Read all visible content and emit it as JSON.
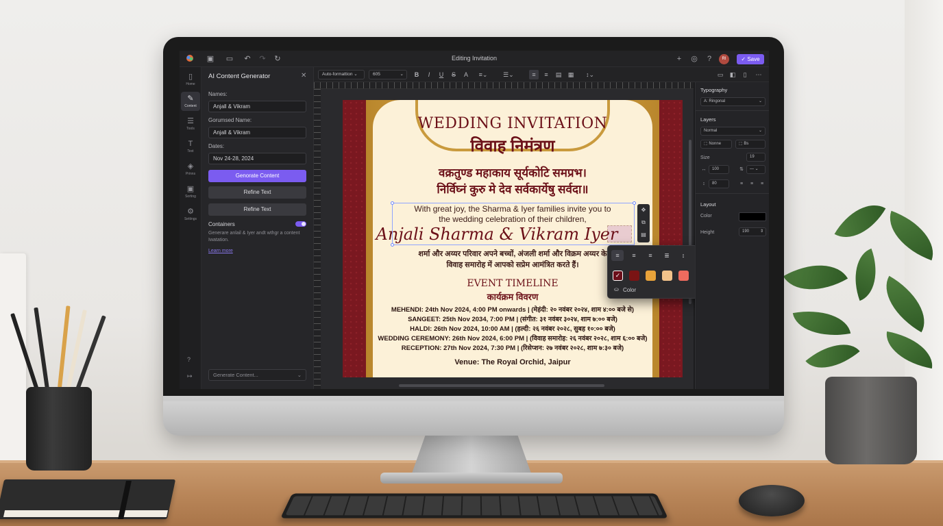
{
  "app": {
    "title": "Editing Invitation",
    "save_label": "Save",
    "avatar_initials": "RI"
  },
  "rail": {
    "items": [
      {
        "label": "Home",
        "icon": "layout-icon"
      },
      {
        "label": "Content",
        "icon": "magic-pen-icon"
      },
      {
        "label": "Tools",
        "icon": "tools-icon"
      },
      {
        "label": "Text",
        "icon": "text-icon"
      },
      {
        "label": "Prinns",
        "icon": "print-icon"
      },
      {
        "label": "Sorting",
        "icon": "sort-icon"
      },
      {
        "label": "Settings",
        "icon": "gear-icon"
      }
    ]
  },
  "ai_panel": {
    "title": "AI Content Generator",
    "names_label": "Names:",
    "names_value": "Anjall & Vikram",
    "combined_label": "Gorumsed Name:",
    "combined_value": "Anjall & Vikram",
    "dates_label": "Dates:",
    "dates_value": "Nov 24-28, 2024",
    "generate_label": "Genorate Content",
    "refine_label_1": "Refine Text",
    "refine_label_2": "Refine Text",
    "containers_label": "Containers",
    "containers_desc": "Generare anlail & Iyer andt wthgr a content Iwatation.",
    "learn_more": "Learn more",
    "bottom_select": "Generate Content..."
  },
  "toolbar": {
    "format_select": "Auto-formattion",
    "size_select": "605"
  },
  "invitation": {
    "heading_en": "WEDDING INVITATION",
    "heading_hi": "विवाह निमंत्रण",
    "shloka_1": "वक्रतुण्ड महाकाय सूर्यकोटि समप्रभ।",
    "shloka_2": "निर्विघ्नं कुरु मे देव सर्वकार्येषु सर्वदा॥",
    "invite_1": "With great joy, the Sharma & Iyer families invite you to",
    "invite_2": "the wedding celebration of their children,",
    "couple": "Anjali Sharma & Vikram Iyer",
    "invite_hi_1": "शर्मा और अय्यर परिवार अपने बच्चों, अंजली शर्मा और विक्रम अय्यर के",
    "invite_hi_2": "विवाह समारोह में आपको सप्रेम आमंत्रित करते हैं।",
    "timeline_en": "EVENT TIMELINE",
    "timeline_hi": "कार्यक्रम विवरण",
    "events": [
      "MEHENDI: 24th Nov 2024, 4:00 PM onwards | (मेहंदी: २० नवंबर २०२४, शाम ४:०० बजे से)",
      "SANGEET: 25th Nov 2034, 7:00 PM | (संगीत: ३१ नवंबर ३०२४, शाम ७:०० बजे)",
      "HALDI: 26th Nov 2024, 10:00 AM | (हल्दी: २६ नवंबर २०२८, सुबह १०:०० बजे)",
      "WEDDING CEREMONY: 26th Nov 2024, 6:00 PM | (विवाह समारोह: २६ नवंबर २०२८, शाम ६:०० बजे)",
      "RECEPTION: 27th Nov 2024, 7:30 PM | (रिसेप्शन: २७ नवंबर २०२८, शाम ७:३० बजे)"
    ],
    "venue": "Venue: The Royal Orchid, Jaipur"
  },
  "popover": {
    "color_label": "Color",
    "swatches": [
      "#6b0f1a",
      "#7a1414",
      "#e8a33a",
      "#f2c28a",
      "#ee6b5e",
      "#6e9a6c"
    ]
  },
  "right_panel": {
    "typography": "Typography",
    "font_select": "Ringonal",
    "layers": "Layers",
    "blend_select": "Normal",
    "layer_a": "Nonne",
    "layer_b": "Bs",
    "size": "Size",
    "size_value": "19",
    "width_value": "100",
    "line_value": "80",
    "layout": "Layout",
    "color": "Color",
    "color_value": "#000000",
    "height": "Height",
    "height_value": "190"
  }
}
